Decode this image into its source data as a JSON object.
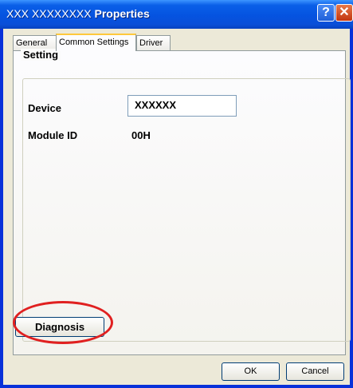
{
  "window": {
    "title_prefix": "XXX XXXXXXXX",
    "title_suffix": "Properties",
    "help_glyph": "?",
    "close_glyph": "✕"
  },
  "tabs": [
    {
      "label": "General",
      "selected": false
    },
    {
      "label": "Common Settings",
      "selected": true
    },
    {
      "label": "Driver",
      "selected": false
    }
  ],
  "group": {
    "legend": "Setting",
    "device_label": "Device",
    "device_value": "XXXXXX",
    "module_id_label": "Module ID",
    "module_id_value": "00H"
  },
  "diagnosis_label": "Diagnosis",
  "buttons": {
    "ok": "OK",
    "cancel": "Cancel"
  },
  "colors": {
    "highlight": "#e02020",
    "titlebar": "#0553e0",
    "tab_accent": "#ffc83c"
  }
}
